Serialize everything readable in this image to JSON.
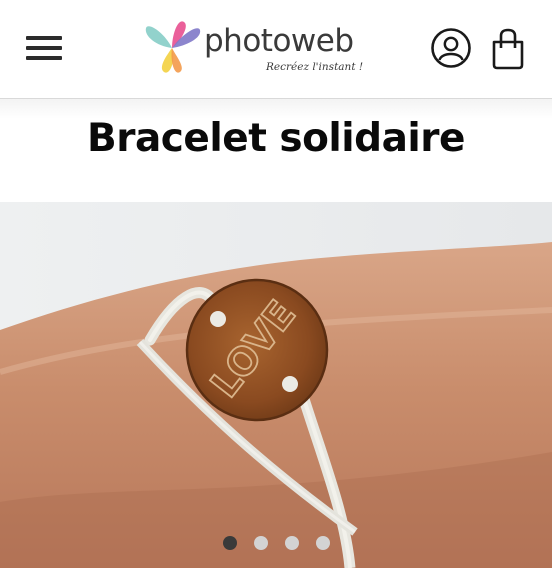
{
  "header": {
    "logo_text": "photoweb",
    "logo_tagline": "Recréez l'instant !"
  },
  "main": {
    "title": "Bracelet solidaire",
    "carousel": {
      "pendant_text": "LOVE",
      "slide_count": 4,
      "active_slide": 1
    }
  },
  "icons": {
    "menu": "hamburger-menu-icon",
    "account": "user-icon",
    "cart": "shopping-bag-icon"
  },
  "colors": {
    "title": "#0a0a0a",
    "dot_active": "#3a3a3a",
    "dot_inactive": "#d3d3d3",
    "header_border": "#d9d9d9"
  }
}
